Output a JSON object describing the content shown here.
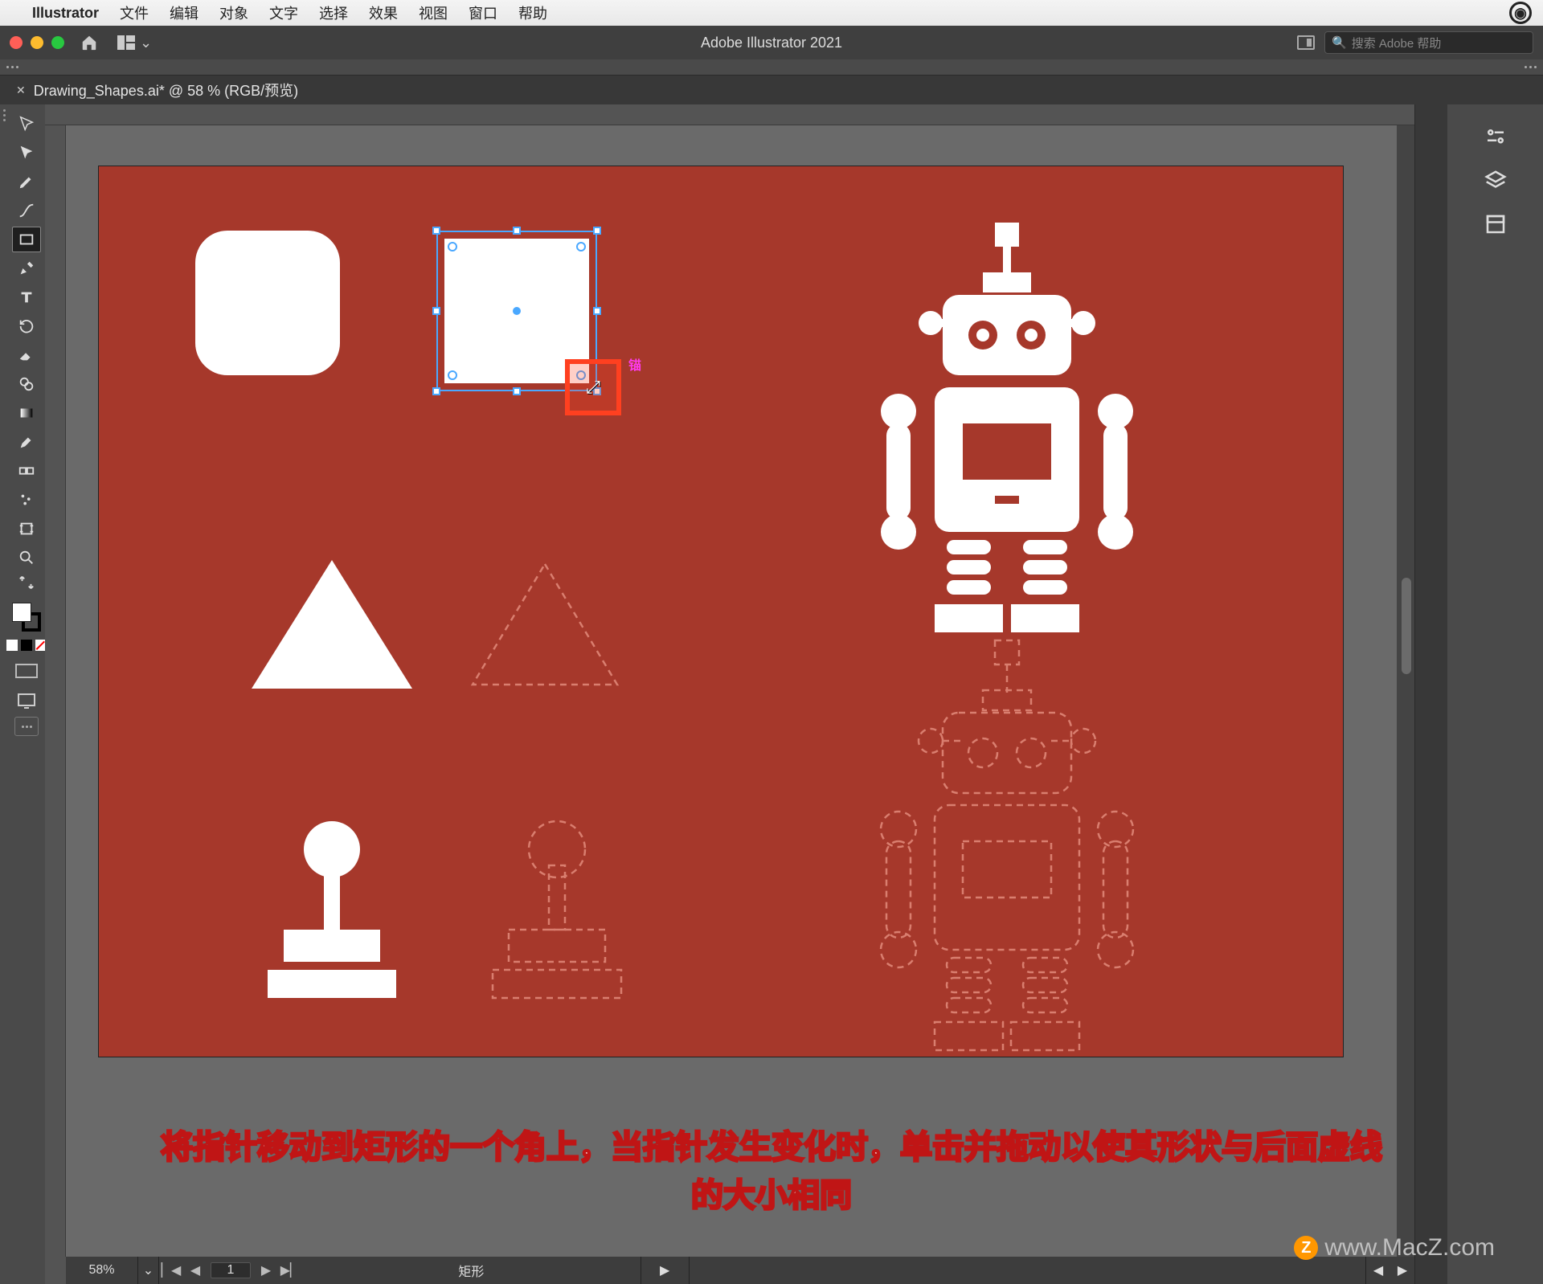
{
  "menubar": {
    "app": "Illustrator",
    "items": [
      "文件",
      "编辑",
      "对象",
      "文字",
      "选择",
      "效果",
      "视图",
      "窗口",
      "帮助"
    ]
  },
  "titlebar": {
    "title": "Adobe Illustrator 2021",
    "search_placeholder": "搜索 Adobe 帮助"
  },
  "tab": {
    "filename": "Drawing_Shapes.ai* @ 58 % (RGB/预览)"
  },
  "tools": {
    "items": [
      {
        "name": "selection",
        "label": "选择"
      },
      {
        "name": "direct-selection",
        "label": "直接选择"
      },
      {
        "name": "pen",
        "label": "钢笔"
      },
      {
        "name": "curvature",
        "label": "曲率"
      },
      {
        "name": "rectangle",
        "label": "矩形",
        "active": true
      },
      {
        "name": "paintbrush",
        "label": "画笔"
      },
      {
        "name": "type",
        "label": "文字"
      },
      {
        "name": "rotate",
        "label": "旋转"
      },
      {
        "name": "eraser",
        "label": "橡皮擦"
      },
      {
        "name": "shape-builder",
        "label": "形状生成器"
      },
      {
        "name": "gradient",
        "label": "渐变"
      },
      {
        "name": "eyedropper",
        "label": "吸管"
      },
      {
        "name": "blend",
        "label": "混合"
      },
      {
        "name": "symbol-sprayer",
        "label": "符号喷枪"
      },
      {
        "name": "artboard",
        "label": "画板"
      },
      {
        "name": "zoom",
        "label": "缩放"
      }
    ]
  },
  "right_panel": {
    "icons": [
      {
        "name": "properties",
        "label": "属性"
      },
      {
        "name": "layers",
        "label": "图层"
      },
      {
        "name": "libraries",
        "label": "库"
      }
    ]
  },
  "canvas": {
    "artboard_bg": "#a6382b",
    "selected_shape_tag": "锚",
    "shapes": {
      "rounded_rect": "rounded-rect",
      "selected_rect": "selected-rect",
      "triangle_solid": "triangle",
      "triangle_dashed": "triangle-outline",
      "joystick_solid": "joystick",
      "joystick_dashed": "joystick-outline",
      "robot_solid": "robot",
      "robot_dashed": "robot-outline"
    }
  },
  "statusbar": {
    "zoom": "58%",
    "page": "1",
    "tool_label": "矩形"
  },
  "caption": {
    "line1": "将指针移动到矩形的一个角上，当指针发生变化时，单击并拖动以使其形状与后面虚线",
    "line2": "的大小相同"
  },
  "watermark": "www.MacZ.com"
}
